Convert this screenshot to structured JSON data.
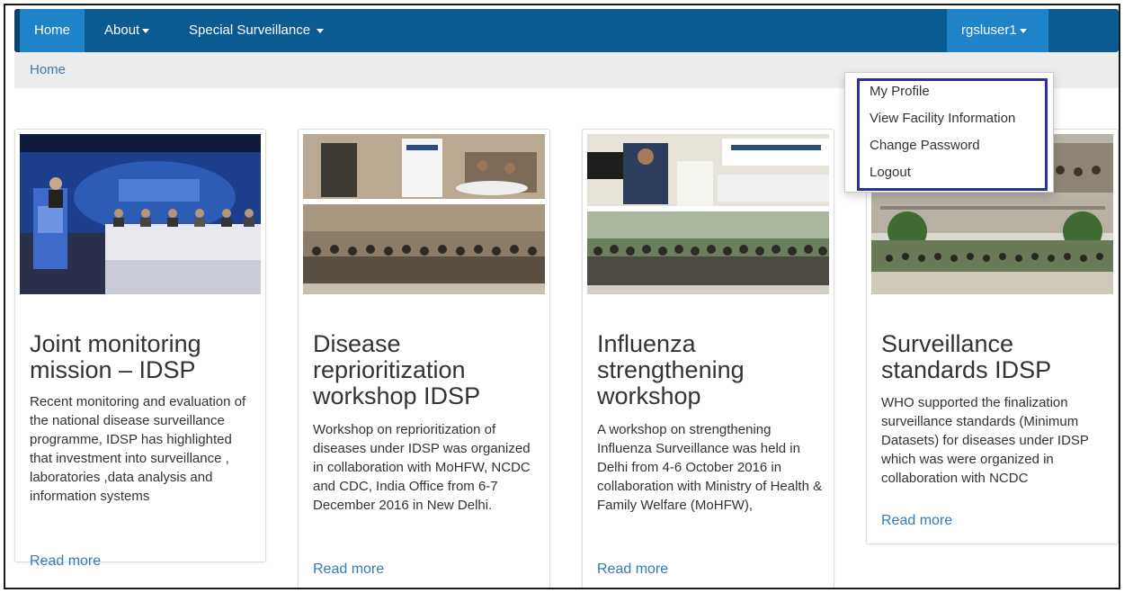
{
  "navbar": {
    "home": "Home",
    "about": "About",
    "special_surveillance": "Special Surveillance",
    "user": "rgsluser1"
  },
  "breadcrumb": {
    "home": "Home"
  },
  "user_menu": {
    "items": [
      "My Profile",
      "View Facility Information",
      "Change Password",
      "Logout"
    ]
  },
  "cards": [
    {
      "title": "Joint monitoring mission – IDSP",
      "body": "Recent monitoring and evaluation of the national disease surveillance programme, IDSP has highlighted that investment into surveillance , laboratories ,data analysis and information systems",
      "link": "Read more"
    },
    {
      "title": "Disease reprioritization workshop IDSP",
      "body": "Workshop on reprioritization of diseases under IDSP was organized in collaboration with MoHFW, NCDC and CDC, India Office from 6-7 December 2016 in New Delhi.",
      "link": "Read more"
    },
    {
      "title": "Influenza strengthening workshop",
      "body": "A workshop on strengthening Influenza Surveillance was held in Delhi from 4-6 October 2016 in collaboration with Ministry of Health & Family Welfare (MoHFW),",
      "link": "Read more"
    },
    {
      "title": "Surveillance standards IDSP",
      "body": "WHO supported the finalization surveillance standards (Minimum Datasets) for diseases under IDSP which was were organized in collaboration with NCDC",
      "link": "Read more"
    }
  ],
  "colors": {
    "navbar": "#0b5a91",
    "nav_active": "#1e83c9",
    "link": "#337ab7",
    "menu_highlight": "#2b2ea8"
  }
}
